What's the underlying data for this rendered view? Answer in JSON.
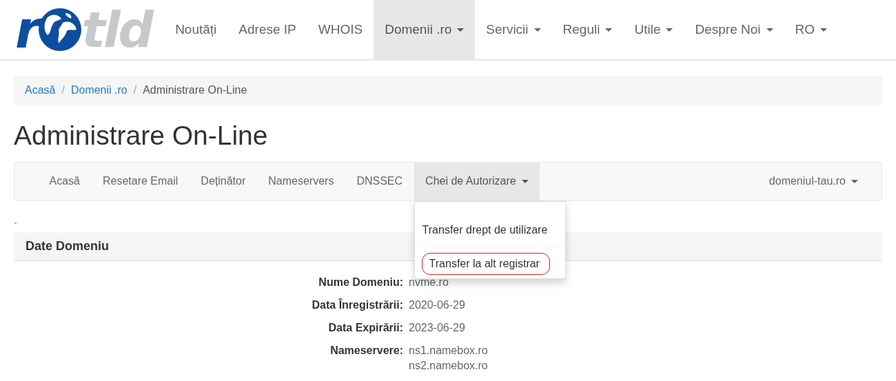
{
  "logo": {
    "lead": "r",
    "tail": "tld"
  },
  "top_nav": [
    {
      "label": "Noutăți",
      "dropdown": false,
      "selected": false
    },
    {
      "label": "Adrese IP",
      "dropdown": false,
      "selected": false
    },
    {
      "label": "WHOIS",
      "dropdown": false,
      "selected": false
    },
    {
      "label": "Domenii .ro",
      "dropdown": true,
      "selected": true
    },
    {
      "label": "Servicii",
      "dropdown": true,
      "selected": false
    },
    {
      "label": "Reguli",
      "dropdown": true,
      "selected": false
    },
    {
      "label": "Utile",
      "dropdown": true,
      "selected": false
    },
    {
      "label": "Despre Noi",
      "dropdown": true,
      "selected": false
    },
    {
      "label": "RO",
      "dropdown": true,
      "selected": false
    }
  ],
  "breadcrumb_separator": "/",
  "breadcrumb": [
    {
      "label": "Acasă",
      "link": true
    },
    {
      "label": "Domenii .ro",
      "link": true
    },
    {
      "label": "Administrare On-Line",
      "link": false
    }
  ],
  "title": "Administrare On-Line",
  "sub_nav": [
    {
      "label": "Acasă",
      "dropdown": false,
      "selected": false
    },
    {
      "label": "Resetare Email",
      "dropdown": false,
      "selected": false
    },
    {
      "label": "Deținător",
      "dropdown": false,
      "selected": false
    },
    {
      "label": "Nameservers",
      "dropdown": false,
      "selected": false
    },
    {
      "label": "DNSSEC",
      "dropdown": false,
      "selected": false
    },
    {
      "label": "Chei de Autorizare",
      "dropdown": true,
      "selected": true
    }
  ],
  "domain_menu": {
    "label": "domeniul-tau.ro"
  },
  "dropdown": {
    "items": [
      {
        "label": "Transfer drept de utilizare",
        "highlighted": false
      },
      {
        "label": "Transfer la alt registrar",
        "highlighted": true
      }
    ]
  },
  "panel": {
    "title": "Date Domeniu",
    "fields": [
      {
        "label": "Nume Domeniu:",
        "values": [
          "nvme.ro"
        ]
      },
      {
        "label": "Data Înregistrării:",
        "values": [
          "2020-06-29"
        ]
      },
      {
        "label": "Data Expirării:",
        "values": [
          "2023-06-29"
        ]
      },
      {
        "label": "Nameservere:",
        "values": [
          "ns1.namebox.ro",
          "ns2.namebox.ro"
        ]
      }
    ]
  }
}
